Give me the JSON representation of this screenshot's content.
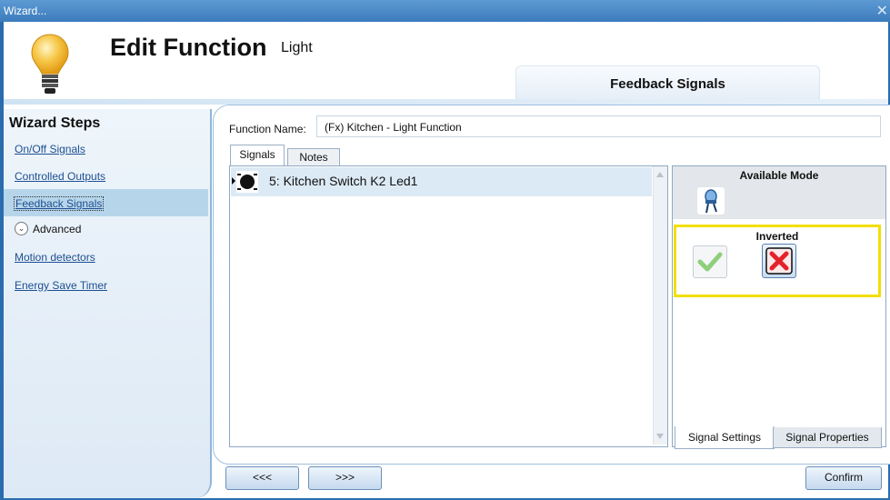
{
  "window": {
    "title": "Wizard...",
    "close_glyph": "✕"
  },
  "header": {
    "title": "Edit Function",
    "subtitle": "Light",
    "section_tab": "Feedback Signals"
  },
  "sidebar": {
    "title": "Wizard Steps",
    "items": [
      {
        "label": "On/Off Signals",
        "active": false
      },
      {
        "label": "Controlled Outputs",
        "active": false
      },
      {
        "label": "Feedback Signals",
        "active": true
      }
    ],
    "advanced_label": "Advanced",
    "advanced_items": [
      {
        "label": "Motion detectors"
      },
      {
        "label": "Energy Save Timer"
      }
    ]
  },
  "main": {
    "function_name_label": "Function Name:",
    "function_name_value": "(Fx) Kitchen - Light Function",
    "tabs": [
      {
        "label": "Signals",
        "selected": true
      },
      {
        "label": "Notes",
        "selected": false
      }
    ],
    "signals": [
      {
        "label": "5: Kitchen Switch K2 Led1",
        "icon": "led-signal-icon"
      }
    ],
    "right_panel": {
      "available_mode_label": "Available Mode",
      "available_mode_icon": "led-mode-icon",
      "inverted_label": "Inverted",
      "inverted_options": [
        {
          "icon": "check-icon",
          "selected": false
        },
        {
          "icon": "x-icon",
          "selected": true
        }
      ],
      "highlight_color": "#f2e000",
      "tabs": [
        {
          "label": "Signal Settings",
          "selected": true
        },
        {
          "label": "Signal Properties",
          "selected": false
        }
      ]
    }
  },
  "footer": {
    "prev_label": "<<<",
    "next_label": ">>>",
    "confirm_label": "Confirm"
  }
}
